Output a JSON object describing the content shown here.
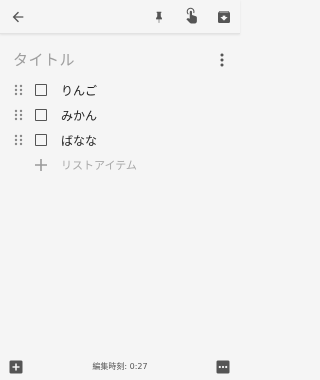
{
  "toolbar": {
    "back_icon": "arrow-back-icon",
    "pin_icon": "pin-icon",
    "reminder_icon": "hand-reminder-icon",
    "archive_icon": "archive-icon"
  },
  "note": {
    "title_placeholder": "タイトル",
    "items": [
      {
        "label": "りんご",
        "checked": false
      },
      {
        "label": "みかん",
        "checked": false
      },
      {
        "label": "ばなな",
        "checked": false
      }
    ],
    "add_item_label": "リストアイテム"
  },
  "footer": {
    "edited_text": "編集時刻: 0:27"
  },
  "colors": {
    "background": "#f5f5f5",
    "icon": "#555555",
    "placeholder": "#9e9e9e"
  }
}
